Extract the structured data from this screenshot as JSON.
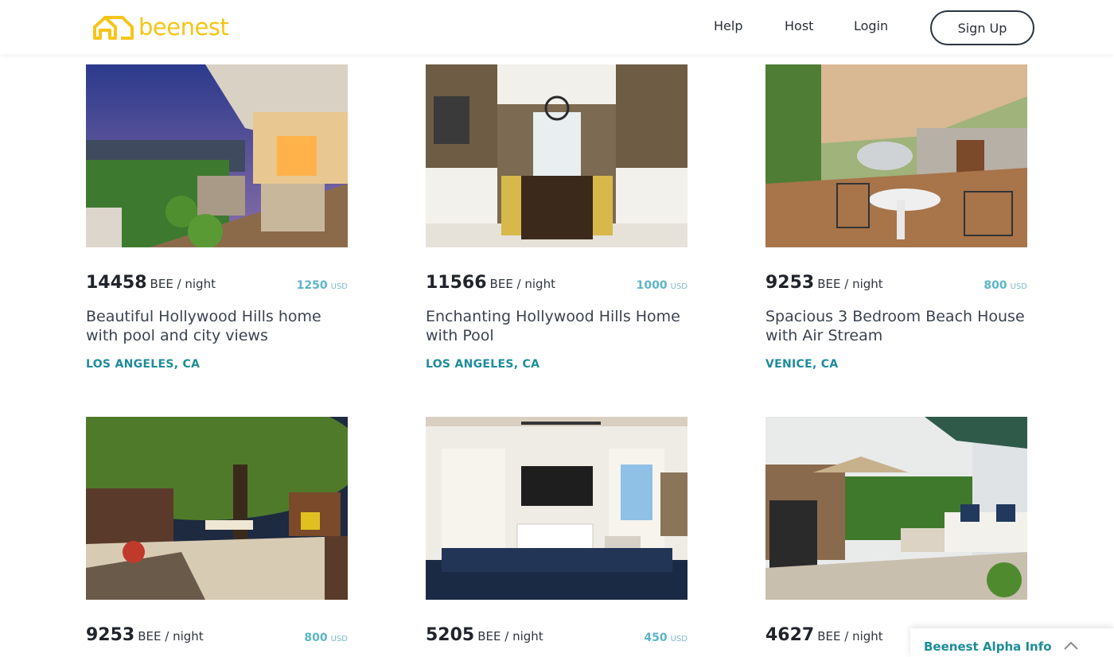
{
  "brand": {
    "name": "beenest",
    "color": "#f5c518"
  },
  "nav": {
    "help": "Help",
    "host": "Host",
    "login": "Login",
    "signup": "Sign Up"
  },
  "listings": [
    {
      "bee_price": "14458",
      "bee_unit": "BEE / night",
      "usd_price": "1250",
      "usd_label": "USD",
      "title": "Beautiful Hollywood Hills home with pool and city views",
      "location": "LOS ANGELES, CA"
    },
    {
      "bee_price": "11566",
      "bee_unit": "BEE / night",
      "usd_price": "1000",
      "usd_label": "USD",
      "title": "Enchanting Hollywood Hills Home with Pool",
      "location": "LOS ANGELES, CA"
    },
    {
      "bee_price": "9253",
      "bee_unit": "BEE / night",
      "usd_price": "800",
      "usd_label": "USD",
      "title": "Spacious 3 Bedroom Beach House with Air Stream",
      "location": "VENICE, CA"
    },
    {
      "bee_price": "9253",
      "bee_unit": "BEE / night",
      "usd_price": "800",
      "usd_label": "USD"
    },
    {
      "bee_price": "5205",
      "bee_unit": "BEE / night",
      "usd_price": "450",
      "usd_label": "USD"
    },
    {
      "bee_price": "4627",
      "bee_unit": "BEE / night"
    }
  ],
  "alpha_info": {
    "label": "Beenest Alpha Info",
    "icon": "chevron-up-icon"
  },
  "colors": {
    "accent": "#1d8d99",
    "usd": "#5bb6c6",
    "text": "#2f3640"
  }
}
